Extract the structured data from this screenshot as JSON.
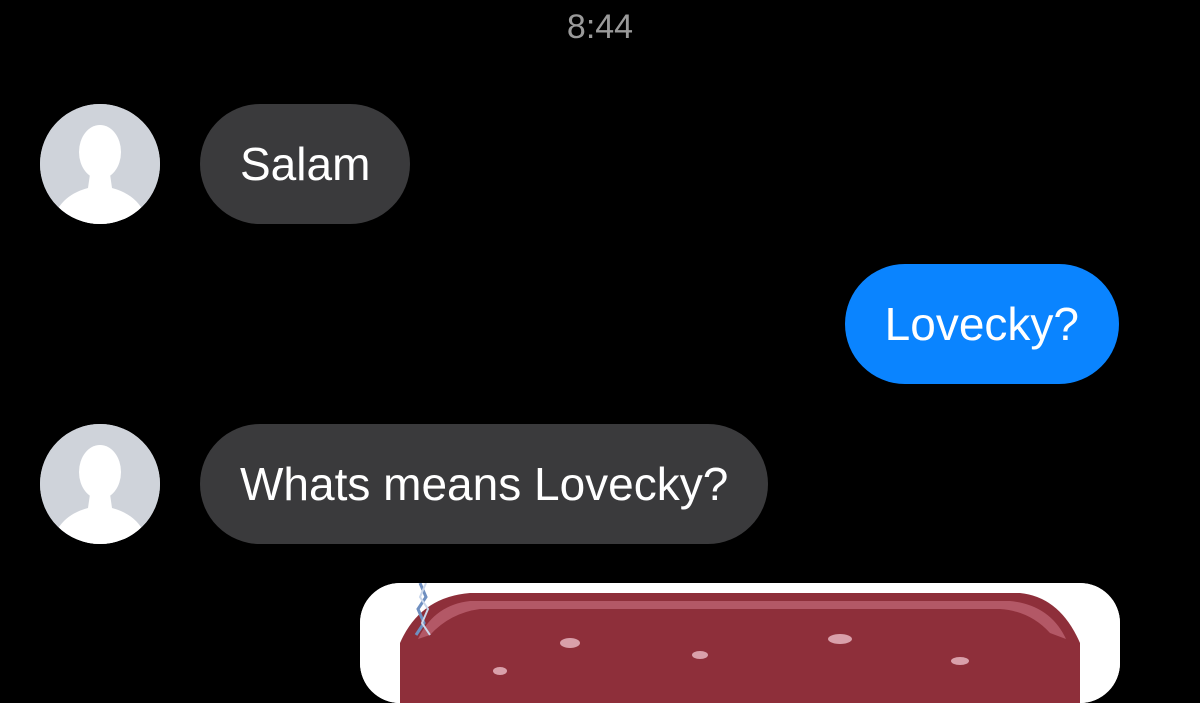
{
  "conversation": {
    "timestamp": "8:44",
    "messages": [
      {
        "direction": "incoming",
        "text": "Salam",
        "avatar_icon": "default-profile-silhouette-icon"
      },
      {
        "direction": "outgoing",
        "text": "Lovecky?"
      },
      {
        "direction": "incoming",
        "text": "Whats means Lovecky?",
        "avatar_icon": "default-profile-silhouette-icon"
      },
      {
        "direction": "outgoing",
        "type": "image",
        "content": "photo-attachment-sausage"
      }
    ]
  },
  "colors": {
    "background": "#000000",
    "incoming_bubble": "#3a3a3c",
    "outgoing_bubble": "#0a84ff",
    "timestamp_text": "#9a9a9a",
    "avatar_bg": "#cfd3da"
  }
}
